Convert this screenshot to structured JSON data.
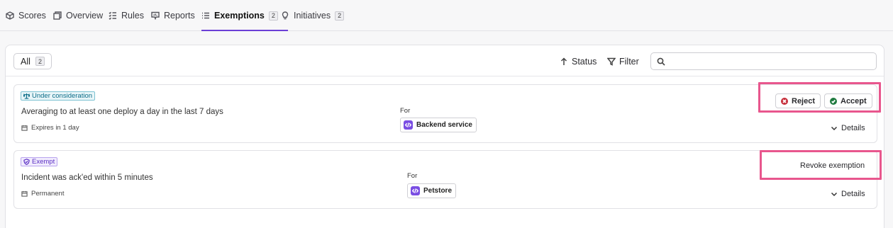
{
  "tabs": [
    {
      "label": "Scores",
      "icon": "cube-icon"
    },
    {
      "label": "Overview",
      "icon": "window-icon"
    },
    {
      "label": "Rules",
      "icon": "checklist-icon"
    },
    {
      "label": "Reports",
      "icon": "report-icon"
    },
    {
      "label": "Exemptions",
      "icon": "list-icon",
      "count": "2",
      "active": true
    },
    {
      "label": "Initiatives",
      "icon": "lightbulb-icon",
      "count": "2"
    }
  ],
  "toolbar": {
    "all_label": "All",
    "all_count": "2",
    "status_label": "Status",
    "filter_label": "Filter",
    "search_placeholder": "",
    "search_value": ""
  },
  "exemptions": [
    {
      "status": "Under consideration",
      "rule": "Averaging to at least one deploy a day in the last 7 days",
      "expiry": "Expires in 1 day",
      "for_label": "For",
      "entity": "Backend service",
      "actions": {
        "reject": "Reject",
        "accept": "Accept"
      },
      "details_label": "Details"
    },
    {
      "status": "Exempt",
      "rule": "Incident was ack'ed within 5 minutes",
      "expiry": "Permanent",
      "for_label": "For",
      "entity": "Petstore",
      "actions": {
        "revoke": "Revoke exemption"
      },
      "details_label": "Details"
    }
  ],
  "colors": {
    "accent": "#6b3fd6",
    "highlight": "#e8568d",
    "reject": "#c62d3a",
    "accept": "#1f7a3f",
    "under_consideration": "#0b6d88",
    "exempt": "#5b2fc4"
  }
}
